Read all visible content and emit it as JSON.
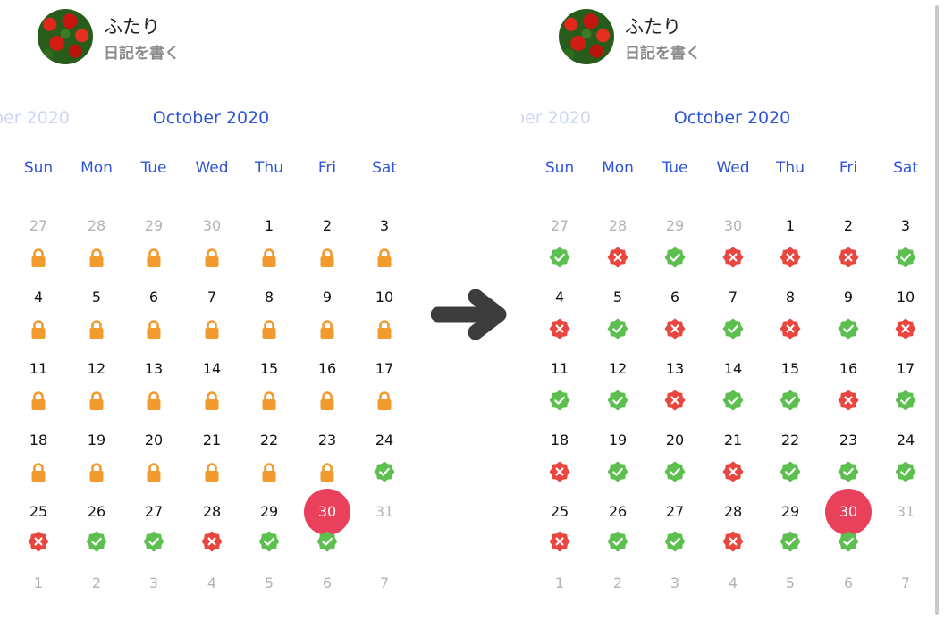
{
  "app": {
    "title": "ふたり",
    "subtitle": "日記を書く"
  },
  "calendar": {
    "prev_month_label": "ber 2020",
    "month_label": "October 2020",
    "weekdays": [
      "Sun",
      "Mon",
      "Tue",
      "Wed",
      "Thu",
      "Fri",
      "Sat"
    ],
    "days": [
      [
        "27",
        "28",
        "29",
        "30",
        "1",
        "2",
        "3"
      ],
      [
        "4",
        "5",
        "6",
        "7",
        "8",
        "9",
        "10"
      ],
      [
        "11",
        "12",
        "13",
        "14",
        "15",
        "16",
        "17"
      ],
      [
        "18",
        "19",
        "20",
        "21",
        "22",
        "23",
        "24"
      ],
      [
        "25",
        "26",
        "27",
        "28",
        "29",
        "30",
        "31"
      ],
      [
        "1",
        "2",
        "3",
        "4",
        "5",
        "6",
        "7"
      ]
    ],
    "muted_cells": [
      [
        0,
        0
      ],
      [
        0,
        1
      ],
      [
        0,
        2
      ],
      [
        0,
        3
      ],
      [
        4,
        6
      ],
      [
        5,
        0
      ],
      [
        5,
        1
      ],
      [
        5,
        2
      ],
      [
        5,
        3
      ],
      [
        5,
        4
      ],
      [
        5,
        5
      ],
      [
        5,
        6
      ]
    ],
    "today_cell": [
      4,
      5
    ]
  },
  "status_before": [
    [
      "lock",
      "lock",
      "lock",
      "lock",
      "lock",
      "lock",
      "lock"
    ],
    [
      "lock",
      "lock",
      "lock",
      "lock",
      "lock",
      "lock",
      "lock"
    ],
    [
      "lock",
      "lock",
      "lock",
      "lock",
      "lock",
      "lock",
      "lock"
    ],
    [
      "lock",
      "lock",
      "lock",
      "lock",
      "lock",
      "lock",
      "check"
    ],
    [
      "cross",
      "check",
      "check",
      "cross",
      "check",
      "check",
      ""
    ]
  ],
  "status_after": [
    [
      "check",
      "cross",
      "check",
      "cross",
      "cross",
      "cross",
      "check"
    ],
    [
      "cross",
      "check",
      "cross",
      "check",
      "cross",
      "check",
      "cross"
    ],
    [
      "check",
      "check",
      "cross",
      "check",
      "check",
      "cross",
      "check"
    ],
    [
      "cross",
      "check",
      "check",
      "cross",
      "check",
      "check",
      "check"
    ],
    [
      "cross",
      "check",
      "check",
      "cross",
      "check",
      "check",
      ""
    ]
  ],
  "icons": {
    "lock": "lock-icon",
    "check": "check-badge-icon",
    "cross": "cross-badge-icon",
    "arrow": "arrow-right-icon"
  },
  "colors": {
    "accent": "#2f54d8",
    "lock": "#f29a2e",
    "check": "#5cbf4f",
    "cross": "#e8463f",
    "today": "#e9405c"
  }
}
